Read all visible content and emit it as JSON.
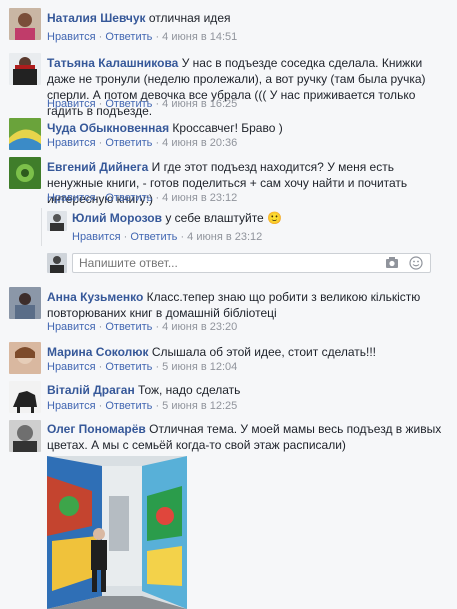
{
  "actions": {
    "like": "Нравится",
    "reply": "Ответить",
    "sep": "·"
  },
  "comments": [
    {
      "author": "Наталия Шевчук",
      "text": "отличная идея",
      "time": "4 июня в 14:51"
    },
    {
      "author": "Татьяна Калашникова",
      "text": "У нас в подъезде соседка сделала. Книжки даже не тронули (неделю пролежали), а вот ручку (там была ручка) сперли. А потом девочка все убрала ((( У нас приживается только гадить в подъезде.",
      "time": "4 июня в 16:25"
    },
    {
      "author": "Чуда Обыкновенная",
      "text": "Кроссавчег! Браво )",
      "time": "4 июня в 20:36"
    },
    {
      "author": "Евгений Дийнега",
      "text": "И где этот подъезд находится? У меня есть ненужные книги, - готов поделиться + сам хочу найти и почитать интересную книгу:)",
      "time": "4 июня в 23:12"
    },
    {
      "author": "Анна Кузьменко",
      "text": "Класс.тепер знаю що робити з великою кількістю повторюваних книг в домашній бібліотеці",
      "time": "4 июня в 23:20"
    },
    {
      "author": "Марина Соколюк",
      "text": "Слышала об этой идее, стоит сделать!!!",
      "time": "5 июня в 12:04"
    },
    {
      "author": "Віталій Драган",
      "text": "Тож, надо сделать",
      "time": "5 июня в 12:25"
    },
    {
      "author": "Олег Пономарёв",
      "text": "Отличная тема. У моей мамы весь подъезд в живых цветах. А мы с семьёй когда-то свой этаж расписали)",
      "time": ""
    }
  ],
  "reply": {
    "author": "Юлий Морозов",
    "text": "у себе влаштуйте",
    "emoji": "🙂",
    "time": "4 июня в 23:12"
  },
  "reply_input": {
    "placeholder": "Напишите ответ..."
  },
  "icons": {
    "camera": "camera-icon",
    "smiley": "smiley-icon"
  }
}
